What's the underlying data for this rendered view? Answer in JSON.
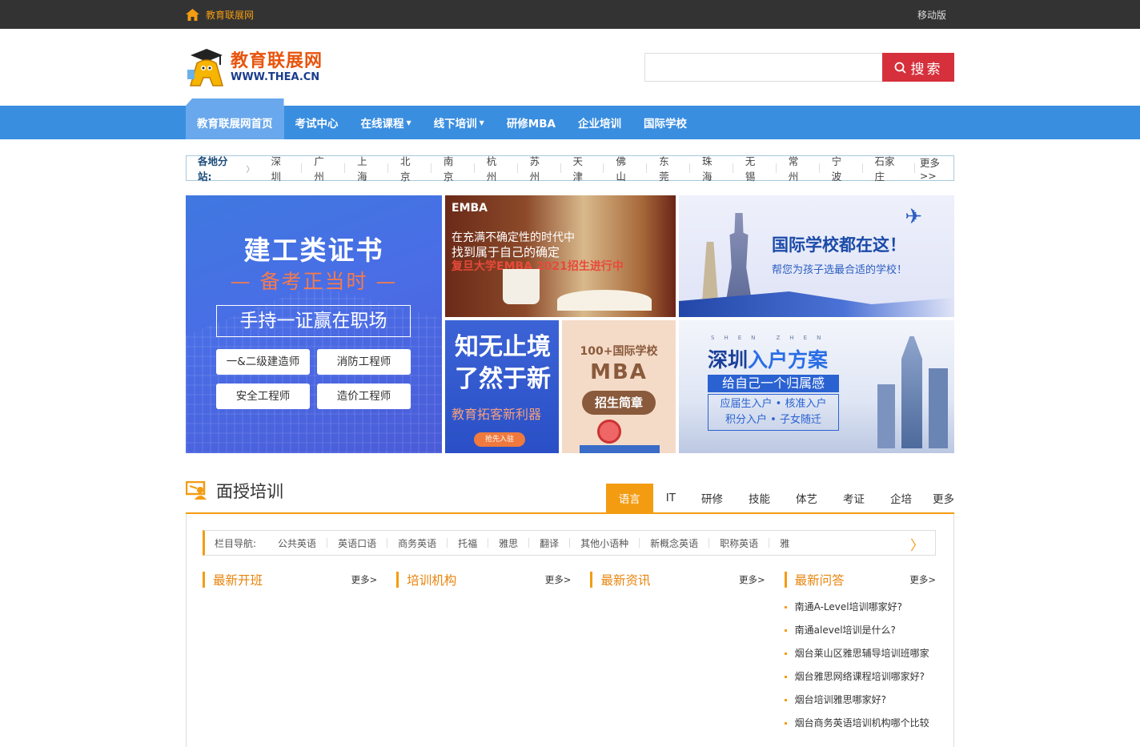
{
  "topbar": {
    "home_label": "教育联展网",
    "mobile_label": "移动版"
  },
  "header": {
    "logo_cn": "教育联展网",
    "logo_en": "WWW.THEA.CN",
    "search_placeholder": "",
    "search_button": "搜索"
  },
  "nav": {
    "items": [
      {
        "label": "教育联展网首页",
        "active": true
      },
      {
        "label": "考试中心"
      },
      {
        "label": "在线课程",
        "caret": true
      },
      {
        "label": "线下培训",
        "caret": true
      },
      {
        "label": "研修MBA"
      },
      {
        "label": "企业培训"
      },
      {
        "label": "国际学校"
      }
    ]
  },
  "branch": {
    "label": "各地分站:",
    "cities": [
      "深圳",
      "广州",
      "上海",
      "北京",
      "南京",
      "杭州",
      "苏州",
      "天津",
      "佛山",
      "东莞",
      "珠海",
      "无锡",
      "常州",
      "宁波",
      "石家庄"
    ],
    "more": "更多>>"
  },
  "banners": {
    "b1": {
      "title": "建工类证书",
      "sub": "— 备考正当时 —",
      "box": "手持一证赢在职场",
      "btn1": "一&二级建造师",
      "btn2": "消防工程师",
      "btn3": "安全工程师",
      "btn4": "造价工程师"
    },
    "b2": {
      "logo": "EMBA",
      "l1": "在充满不确定性的时代中",
      "l2": "找到属于自己的确定",
      "l3": "复旦大学EMBA 2021招生进行中"
    },
    "b3": {
      "t1": "国际学校都在这！",
      "t2": "帮您为孩子选最合适的学校！"
    },
    "b4": {
      "l1": "知无止境",
      "l2": "了然于新",
      "t2": "教育拓客新利器",
      "btn": "抢先入驻"
    },
    "b5": {
      "t1": "100+国际学校",
      "t2": "MBA",
      "btn": "招生简章"
    },
    "b6": {
      "sz": "SHEN ZHEN",
      "t1a": "深圳",
      "t1b": "入户方案",
      "bar": "给自己一个归属感",
      "l1": "应届生入户 • 核准入户",
      "l2": "积分入户 • 子女随迁"
    }
  },
  "section": {
    "title": "面授培训",
    "tabs": [
      "语言",
      "IT",
      "研修",
      "技能",
      "体艺",
      "考证",
      "企培",
      "更多"
    ]
  },
  "subnav": {
    "label": "栏目导航:",
    "items": [
      "公共英语",
      "英语口语",
      "商务英语",
      "托福",
      "雅思",
      "翻译",
      "其他小语种",
      "新概念英语",
      "职称英语",
      "雅"
    ]
  },
  "columns": [
    {
      "title": "最新开班",
      "more": "更多>",
      "items": []
    },
    {
      "title": "培训机构",
      "more": "更多>",
      "items": []
    },
    {
      "title": "最新资讯",
      "more": "更多>",
      "items": []
    },
    {
      "title": "最新问答",
      "more": "更多>",
      "items": [
        "南通A-Level培训哪家好?",
        "南通alevel培训是什么?",
        "烟台莱山区雅思辅导培训班哪家",
        "烟台雅思网络课程培训哪家好?",
        "烟台培训雅思哪家好?",
        "烟台商务英语培训机构哪个比较"
      ]
    }
  ]
}
